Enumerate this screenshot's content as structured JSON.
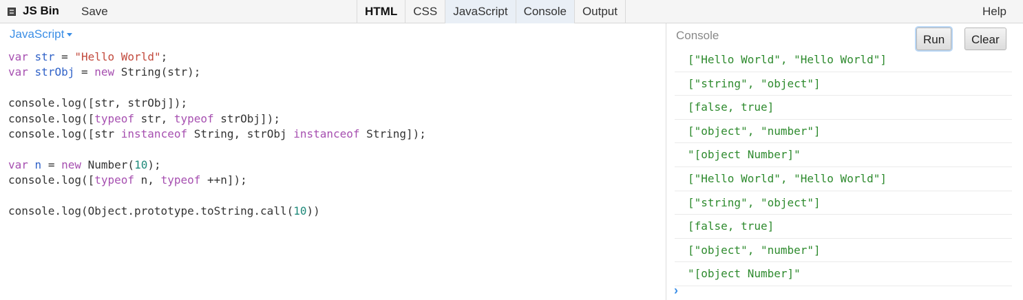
{
  "app": {
    "title": "JS Bin",
    "save_label": "Save",
    "help_label": "Help"
  },
  "panels": [
    {
      "label": "HTML"
    },
    {
      "label": "CSS"
    },
    {
      "label": "JavaScript"
    },
    {
      "label": "Console"
    },
    {
      "label": "Output"
    }
  ],
  "editor": {
    "language_label": "JavaScript",
    "code_lines": [
      "var str = \"Hello World\";",
      "var strObj = new String(str);",
      "",
      "console.log([str, strObj]);",
      "console.log([typeof str, typeof strObj]);",
      "console.log([str instanceof String, strObj instanceof String]);",
      "",
      "var n = new Number(10);",
      "console.log([typeof n, typeof ++n]);",
      "",
      "console.log(Object.prototype.toString.call(10))"
    ]
  },
  "console": {
    "title": "Console",
    "run_label": "Run",
    "clear_label": "Clear",
    "output": [
      "[\"Hello World\", \"Hello World\"]",
      "[\"string\", \"object\"]",
      "[false, true]",
      "[\"object\", \"number\"]",
      "\"[object Number]\"",
      "[\"Hello World\", \"Hello World\"]",
      "[\"string\", \"object\"]",
      "[false, true]",
      "[\"object\", \"number\"]",
      "\"[object Number]\""
    ],
    "prompt": "›"
  }
}
